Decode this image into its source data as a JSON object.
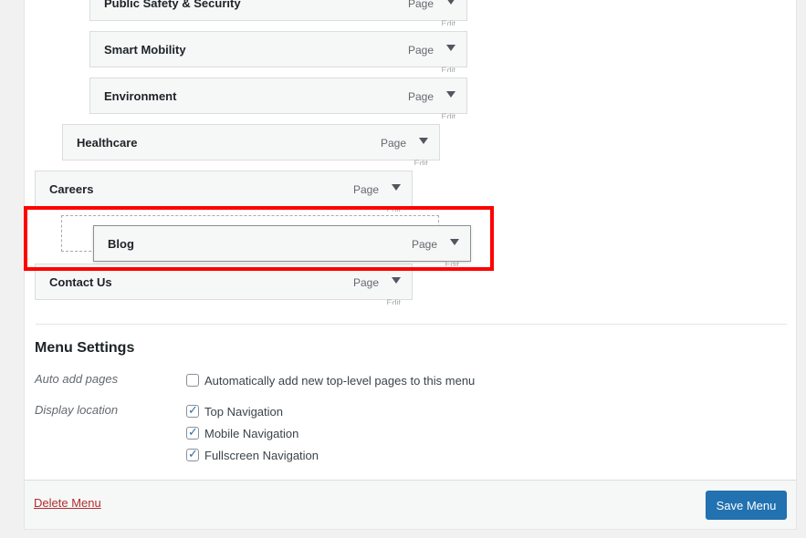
{
  "menu_items": [
    {
      "title": "Public Safety & Security",
      "type": "Page",
      "edit": "Edit"
    },
    {
      "title": "Smart Mobility",
      "type": "Page",
      "edit": "Edit"
    },
    {
      "title": "Environment",
      "type": "Page",
      "edit": "Edit"
    },
    {
      "title": "Healthcare",
      "type": "Page",
      "edit": "Edit"
    },
    {
      "title": "Careers",
      "type": "Page",
      "edit": "Edit"
    },
    {
      "title": "Blog",
      "type": "Page",
      "edit": "Edit"
    },
    {
      "title": "Contact Us",
      "type": "Page",
      "edit": "Edit"
    }
  ],
  "settings": {
    "title": "Menu Settings",
    "auto_add_label": "Auto add pages",
    "auto_add_option": "Automatically add new top-level pages to this menu",
    "display_location_label": "Display location",
    "locations": [
      {
        "label": "Top Navigation",
        "checked": true
      },
      {
        "label": "Mobile Navigation",
        "checked": true
      },
      {
        "label": "Fullscreen Navigation",
        "checked": true
      }
    ]
  },
  "footer": {
    "delete_label": "Delete Menu",
    "save_label": "Save Menu"
  },
  "colors": {
    "accent": "#2271b1",
    "delete": "#b32d2e",
    "highlight": "#ff0000"
  }
}
